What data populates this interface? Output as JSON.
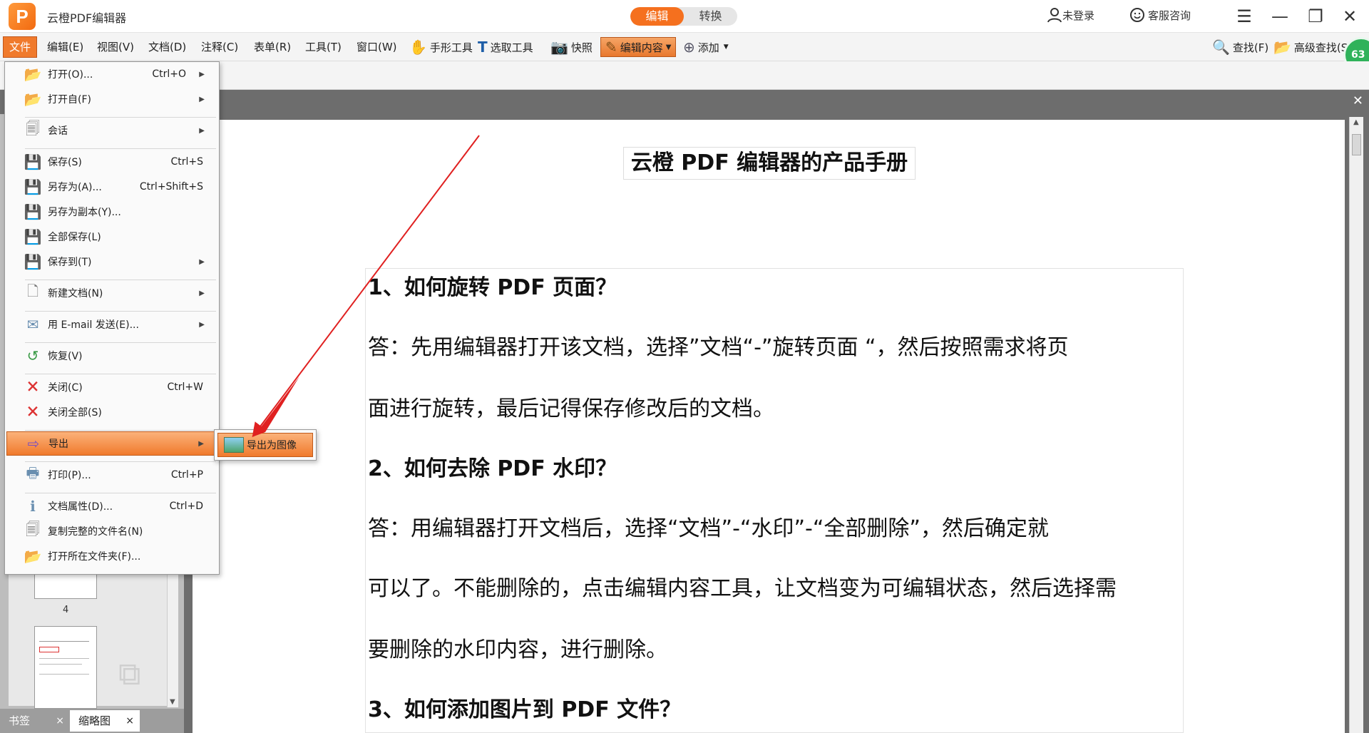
{
  "app": {
    "logo": "P",
    "title": "云橙PDF编辑器"
  },
  "mode_toggle": {
    "edit": "编辑",
    "convert": "转换"
  },
  "title_right": {
    "login": "未登录",
    "support": "客服咨询"
  },
  "menubar": {
    "file": "文件",
    "edit": "编辑(E)",
    "view": "视图(V)",
    "document": "文档(D)",
    "comment": "注释(C)",
    "form": "表单(R)",
    "tools": "工具(T)",
    "window": "窗口(W)"
  },
  "toolbar": {
    "hand": "手形工具",
    "select": "选取工具",
    "snapshot": "快照",
    "edit_content": "编辑内容",
    "add": "添加",
    "find": "查找(F)",
    "adv_find": "高级查找(S)"
  },
  "badge": "63",
  "file_menu": {
    "open": "打开(O)...",
    "open_shortcut": "Ctrl+O",
    "open_from": "打开自(F)",
    "session": "会话",
    "save": "保存(S)",
    "save_shortcut": "Ctrl+S",
    "save_as": "另存为(A)...",
    "save_as_shortcut": "Ctrl+Shift+S",
    "save_copy": "另存为副本(Y)...",
    "save_all": "全部保存(L)",
    "save_to": "保存到(T)",
    "new_doc": "新建文档(N)",
    "email": "用 E-mail 发送(E)...",
    "revert": "恢复(V)",
    "close": "关闭(C)",
    "close_shortcut": "Ctrl+W",
    "close_all": "关闭全部(S)",
    "export": "导出",
    "print": "打印(P)...",
    "print_shortcut": "Ctrl+P",
    "properties": "文档属性(D)...",
    "properties_shortcut": "Ctrl+D",
    "copy_path": "复制完整的文件名(N)",
    "open_folder": "打开所在文件夹(F)..."
  },
  "export_submenu": {
    "to_image": "导出为图像"
  },
  "panel": {
    "thumb_page": "4",
    "tab_bookmark": "书签",
    "tab_thumbnail": "缩略图",
    "close": "×"
  },
  "document": {
    "title": "云橙 PDF 编辑器的产品手册",
    "q1": "1、如何旋转  PDF  页面？",
    "a1_line1": "答：先用编辑器打开该文档，选择”文档“-”旋转页面 “，然后按照需求将页",
    "a1_line2": "面进行旋转，最后记得保存修改后的文档。",
    "q2": "2、如何去除  PDF  水印？",
    "a2_line1": "答：用编辑器打开文档后，选择“文档”-“水印”-“全部删除”，然后确定就",
    "a2_line2": "可以了。不能删除的，点击编辑内容工具，让文档变为可编辑状态，然后选择需",
    "a2_line3": "要删除的水印内容，进行删除。",
    "q3": "3、如何添加图片到  PDF  文件？"
  },
  "colors": {
    "accent": "#f5701e",
    "arrow": "#e02020"
  }
}
